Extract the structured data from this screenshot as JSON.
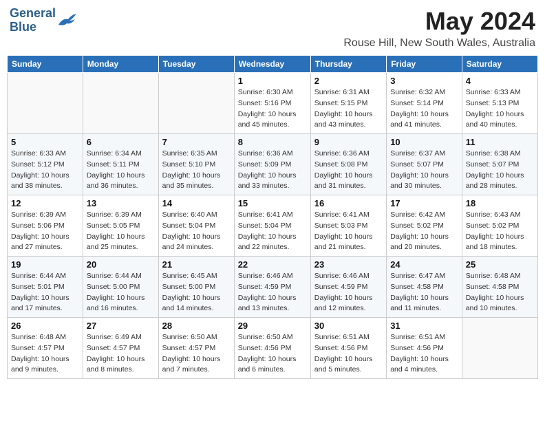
{
  "header": {
    "logo_line1": "General",
    "logo_line2": "Blue",
    "title": "May 2024",
    "subtitle": "Rouse Hill, New South Wales, Australia"
  },
  "days_of_week": [
    "Sunday",
    "Monday",
    "Tuesday",
    "Wednesday",
    "Thursday",
    "Friday",
    "Saturday"
  ],
  "weeks": [
    [
      {
        "day": "",
        "info": ""
      },
      {
        "day": "",
        "info": ""
      },
      {
        "day": "",
        "info": ""
      },
      {
        "day": "1",
        "info": "Sunrise: 6:30 AM\nSunset: 5:16 PM\nDaylight: 10 hours\nand 45 minutes."
      },
      {
        "day": "2",
        "info": "Sunrise: 6:31 AM\nSunset: 5:15 PM\nDaylight: 10 hours\nand 43 minutes."
      },
      {
        "day": "3",
        "info": "Sunrise: 6:32 AM\nSunset: 5:14 PM\nDaylight: 10 hours\nand 41 minutes."
      },
      {
        "day": "4",
        "info": "Sunrise: 6:33 AM\nSunset: 5:13 PM\nDaylight: 10 hours\nand 40 minutes."
      }
    ],
    [
      {
        "day": "5",
        "info": "Sunrise: 6:33 AM\nSunset: 5:12 PM\nDaylight: 10 hours\nand 38 minutes."
      },
      {
        "day": "6",
        "info": "Sunrise: 6:34 AM\nSunset: 5:11 PM\nDaylight: 10 hours\nand 36 minutes."
      },
      {
        "day": "7",
        "info": "Sunrise: 6:35 AM\nSunset: 5:10 PM\nDaylight: 10 hours\nand 35 minutes."
      },
      {
        "day": "8",
        "info": "Sunrise: 6:36 AM\nSunset: 5:09 PM\nDaylight: 10 hours\nand 33 minutes."
      },
      {
        "day": "9",
        "info": "Sunrise: 6:36 AM\nSunset: 5:08 PM\nDaylight: 10 hours\nand 31 minutes."
      },
      {
        "day": "10",
        "info": "Sunrise: 6:37 AM\nSunset: 5:07 PM\nDaylight: 10 hours\nand 30 minutes."
      },
      {
        "day": "11",
        "info": "Sunrise: 6:38 AM\nSunset: 5:07 PM\nDaylight: 10 hours\nand 28 minutes."
      }
    ],
    [
      {
        "day": "12",
        "info": "Sunrise: 6:39 AM\nSunset: 5:06 PM\nDaylight: 10 hours\nand 27 minutes."
      },
      {
        "day": "13",
        "info": "Sunrise: 6:39 AM\nSunset: 5:05 PM\nDaylight: 10 hours\nand 25 minutes."
      },
      {
        "day": "14",
        "info": "Sunrise: 6:40 AM\nSunset: 5:04 PM\nDaylight: 10 hours\nand 24 minutes."
      },
      {
        "day": "15",
        "info": "Sunrise: 6:41 AM\nSunset: 5:04 PM\nDaylight: 10 hours\nand 22 minutes."
      },
      {
        "day": "16",
        "info": "Sunrise: 6:41 AM\nSunset: 5:03 PM\nDaylight: 10 hours\nand 21 minutes."
      },
      {
        "day": "17",
        "info": "Sunrise: 6:42 AM\nSunset: 5:02 PM\nDaylight: 10 hours\nand 20 minutes."
      },
      {
        "day": "18",
        "info": "Sunrise: 6:43 AM\nSunset: 5:02 PM\nDaylight: 10 hours\nand 18 minutes."
      }
    ],
    [
      {
        "day": "19",
        "info": "Sunrise: 6:44 AM\nSunset: 5:01 PM\nDaylight: 10 hours\nand 17 minutes."
      },
      {
        "day": "20",
        "info": "Sunrise: 6:44 AM\nSunset: 5:00 PM\nDaylight: 10 hours\nand 16 minutes."
      },
      {
        "day": "21",
        "info": "Sunrise: 6:45 AM\nSunset: 5:00 PM\nDaylight: 10 hours\nand 14 minutes."
      },
      {
        "day": "22",
        "info": "Sunrise: 6:46 AM\nSunset: 4:59 PM\nDaylight: 10 hours\nand 13 minutes."
      },
      {
        "day": "23",
        "info": "Sunrise: 6:46 AM\nSunset: 4:59 PM\nDaylight: 10 hours\nand 12 minutes."
      },
      {
        "day": "24",
        "info": "Sunrise: 6:47 AM\nSunset: 4:58 PM\nDaylight: 10 hours\nand 11 minutes."
      },
      {
        "day": "25",
        "info": "Sunrise: 6:48 AM\nSunset: 4:58 PM\nDaylight: 10 hours\nand 10 minutes."
      }
    ],
    [
      {
        "day": "26",
        "info": "Sunrise: 6:48 AM\nSunset: 4:57 PM\nDaylight: 10 hours\nand 9 minutes."
      },
      {
        "day": "27",
        "info": "Sunrise: 6:49 AM\nSunset: 4:57 PM\nDaylight: 10 hours\nand 8 minutes."
      },
      {
        "day": "28",
        "info": "Sunrise: 6:50 AM\nSunset: 4:57 PM\nDaylight: 10 hours\nand 7 minutes."
      },
      {
        "day": "29",
        "info": "Sunrise: 6:50 AM\nSunset: 4:56 PM\nDaylight: 10 hours\nand 6 minutes."
      },
      {
        "day": "30",
        "info": "Sunrise: 6:51 AM\nSunset: 4:56 PM\nDaylight: 10 hours\nand 5 minutes."
      },
      {
        "day": "31",
        "info": "Sunrise: 6:51 AM\nSunset: 4:56 PM\nDaylight: 10 hours\nand 4 minutes."
      },
      {
        "day": "",
        "info": ""
      }
    ]
  ]
}
